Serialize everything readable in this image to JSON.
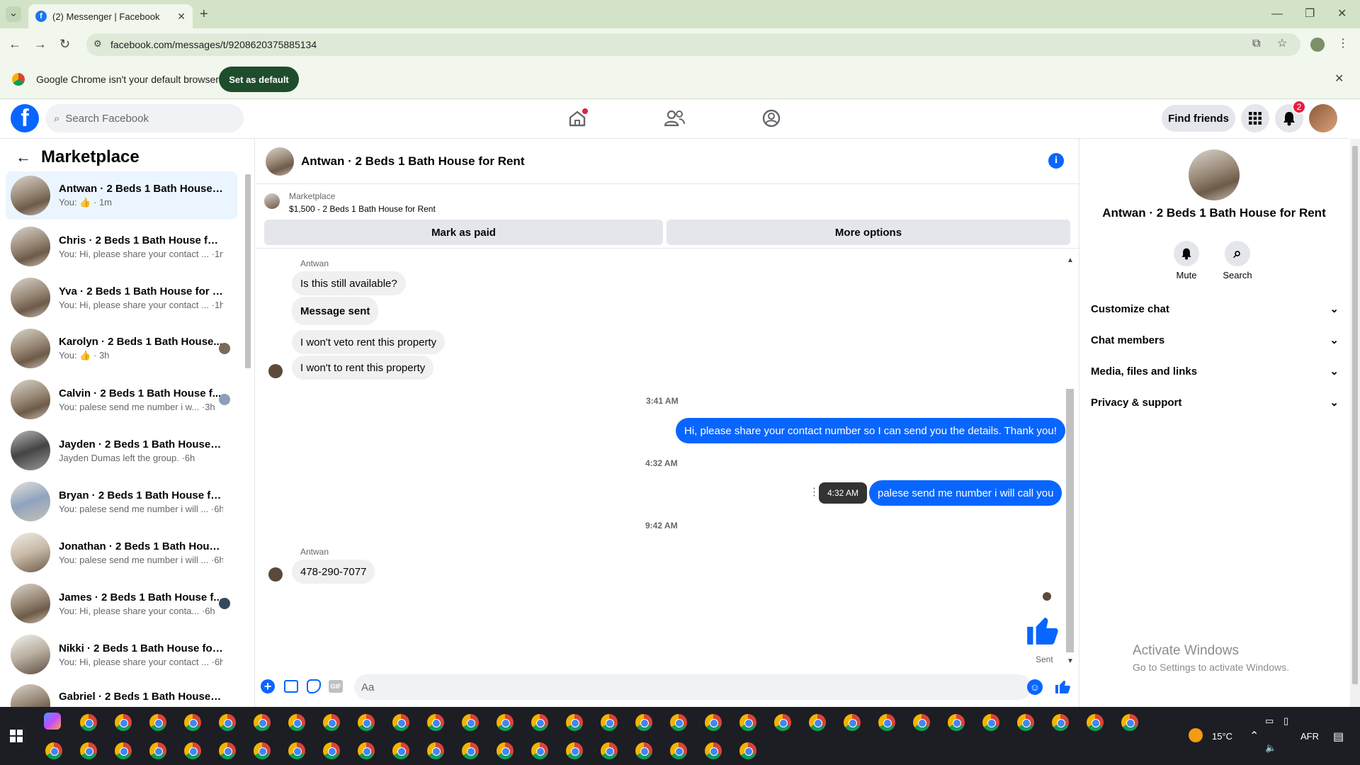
{
  "browser": {
    "tab_title": "(2) Messenger | Facebook",
    "url": "facebook.com/messages/t/9208620375885134",
    "infobar_text": "Google Chrome isn't your default browser",
    "infobar_button": "Set as default"
  },
  "fb_header": {
    "search_placeholder": "Search Facebook",
    "find_friends": "Find friends",
    "notification_count": "2"
  },
  "sidebar": {
    "title": "Marketplace",
    "chats": [
      {
        "name": "Antwan · 2 Beds 1 Bath House f...",
        "preview": "You:",
        "time": "1m",
        "selected": true,
        "like": true
      },
      {
        "name": "Chris · 2 Beds 1 Bath House for ...",
        "preview": "You: Hi, please share your contact ...",
        "time": "1m"
      },
      {
        "name": "Yva · 2 Beds 1 Bath House for Re...",
        "preview": "You: Hi, please share your contact ...",
        "time": "1h"
      },
      {
        "name": "Karolyn · 2 Beds 1 Bath House...",
        "preview": "You:",
        "time": "3h",
        "like": true
      },
      {
        "name": "Calvin · 2 Beds 1 Bath House f...",
        "preview": "You: palese send me number i w...",
        "time": "3h"
      },
      {
        "name": "Jayden · 2 Beds 1 Bath House fo...",
        "preview": "Jayden Dumas left the group.",
        "time": "6h"
      },
      {
        "name": "Bryan · 2 Beds 1 Bath House for ...",
        "preview": "You: palese send me number i will ...",
        "time": "6h"
      },
      {
        "name": "Jonathan · 2 Beds 1 Bath House ...",
        "preview": "You: palese send me number i will ...",
        "time": "6h"
      },
      {
        "name": "James · 2 Beds 1 Bath House f...",
        "preview": "You: Hi, please share your conta...",
        "time": "6h"
      },
      {
        "name": "Nikki · 2 Beds 1 Bath House for ...",
        "preview": "You: Hi, please share your contact ...",
        "time": "6h"
      },
      {
        "name": "Gabriel · 2 Beds 1 Bath House fo...",
        "preview": "",
        "time": ""
      }
    ]
  },
  "chat": {
    "title": "Antwan · 2 Beds 1 Bath House for Rent",
    "marketplace_label": "Marketplace",
    "listing": "$1,500 - 2 Beds 1 Bath House for Rent",
    "mark_paid": "Mark as paid",
    "more_options": "More options",
    "sender1": "Antwan",
    "msg1": "Is this still available?",
    "msg2": "Message sent",
    "msg3": "I won't veto rent this property",
    "msg4": "I won't to rent this property",
    "ts1": "3:41 AM",
    "msg5": "Hi, please share your contact number so I can send you the details. Thank you!",
    "ts2": "4:32 AM",
    "tooltip": "4:32 AM",
    "msg6": "palese send me number i will call you",
    "ts3": "9:42 AM",
    "sender2": "Antwan",
    "msg7": "478-290-7077",
    "sent_status": "Sent",
    "composer_placeholder": "Aa",
    "gif_label": "GIF"
  },
  "details": {
    "name": "Antwan · 2 Beds 1 Bath House for Rent",
    "mute": "Mute",
    "search": "Search",
    "sections": [
      "Customize chat",
      "Chat members",
      "Media, files and links",
      "Privacy & support"
    ]
  },
  "watermark": {
    "title": "Activate Windows",
    "subtitle": "Go to Settings to activate Windows."
  },
  "taskbar": {
    "temperature": "15°C",
    "language": "AFR"
  },
  "colors": {
    "fb_blue": "#0866ff",
    "chrome_green": "#1e4d2b",
    "selected_row": "#ebf5ff"
  }
}
